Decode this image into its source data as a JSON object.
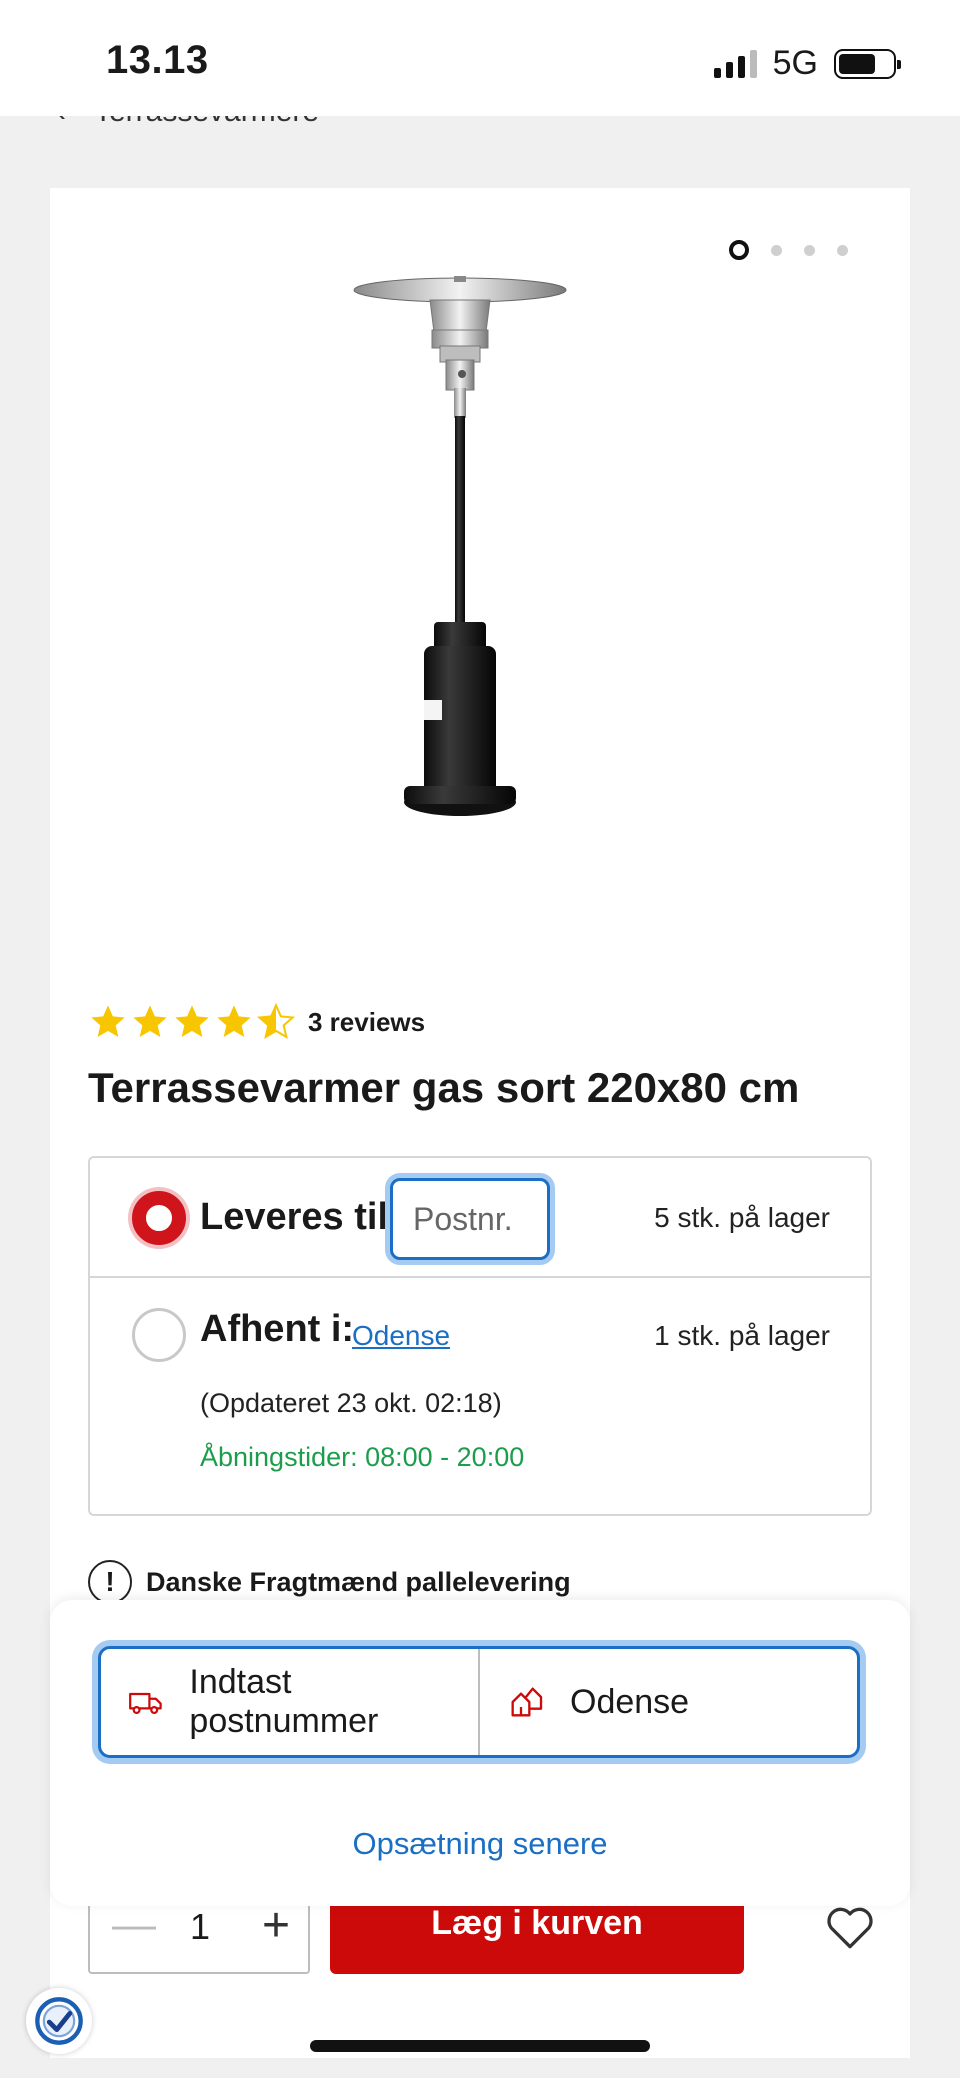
{
  "status_bar": {
    "time": "13.13",
    "network": "5G"
  },
  "breadcrumb": {
    "back_icon": "chevron-left-icon",
    "label": "Terrassevarmere"
  },
  "gallery": {
    "image_count": 4,
    "active_index": 0
  },
  "product": {
    "rating": 4.5,
    "reviews_label": "3 reviews",
    "title": "Terrassevarmer gas sort 220x80 cm"
  },
  "delivery": {
    "deliver_label": "Leveres til:",
    "postnr_placeholder": "Postnr.",
    "deliver_stock": "5 stk. på lager",
    "pickup_label": "Afhent i:",
    "pickup_store": "Odense",
    "pickup_stock": "1 stk. på lager",
    "updated": "(Opdateret 23 okt. 02:18)",
    "hours": "Åbningstider: 08:00 - 20:00"
  },
  "notice": {
    "text": "Danske Fragtmænd pallelevering"
  },
  "sheet": {
    "option_postcode": "Indtast postnummer",
    "option_store": "Odense",
    "setup_later": "Opsætning senere"
  },
  "purchase": {
    "quantity": "1",
    "cart_label": "Læg i kurven"
  },
  "colors": {
    "accent_red": "#cc0a0a",
    "link_blue": "#1a6fc5",
    "stock_green": "#1b9e4b"
  }
}
